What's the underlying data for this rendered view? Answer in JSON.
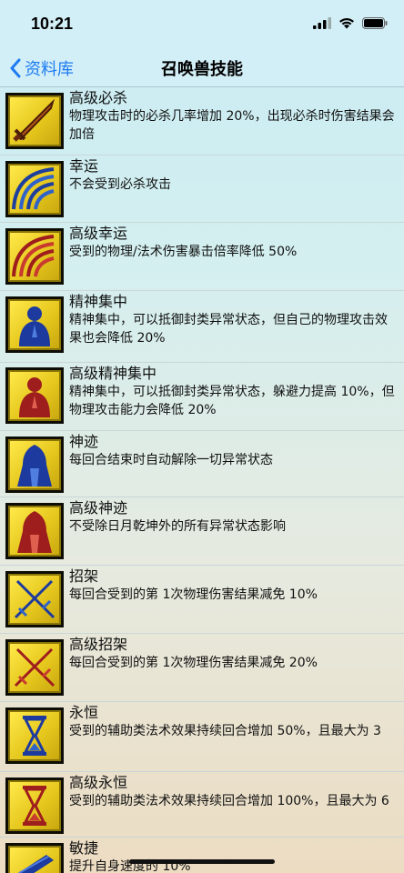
{
  "status": {
    "time": "10:21"
  },
  "nav": {
    "back_label": "资料库",
    "title": "召唤兽技能"
  },
  "skills": [
    {
      "name": "高级必杀",
      "desc": "物理攻击时的必杀几率增加 20%，出现必杀时伤害结果会加倍",
      "icon": "sword-icon"
    },
    {
      "name": "幸运",
      "desc": "不会受到必杀攻击",
      "icon": "blue-rainbow-icon"
    },
    {
      "name": "高级幸运",
      "desc": "受到的物理/法术伤害暴击倍率降低 50%",
      "icon": "red-rainbow-icon"
    },
    {
      "name": "精神集中",
      "desc": "精神集中，可以抵御封类异常状态，但自己的物理攻击效果也会降低 20%",
      "icon": "blue-praying-figure-icon"
    },
    {
      "name": "高级精神集中",
      "desc": "精神集中，可以抵御封类异常状态，躲避力提高 10%，但物理攻击能力会降低 20%",
      "icon": "red-praying-figure-icon"
    },
    {
      "name": "神迹",
      "desc": "每回合结束时自动解除一切异常状态",
      "icon": "blue-hooded-figure-icon"
    },
    {
      "name": "高级神迹",
      "desc": "不受除日月乾坤外的所有异常状态影响",
      "icon": "red-hooded-figure-icon"
    },
    {
      "name": "招架",
      "desc": "每回合受到的第 1次物理伤害结果减免 10%",
      "icon": "blue-crossed-swords-icon"
    },
    {
      "name": "高级招架",
      "desc": "每回合受到的第 1次物理伤害结果减免 20%",
      "icon": "red-crossed-swords-icon"
    },
    {
      "name": "永恒",
      "desc": "受到的辅助类法术效果持续回合增加 50%，且最大为 3",
      "icon": "blue-hourglass-icon"
    },
    {
      "name": "高级永恒",
      "desc": "受到的辅助类法术效果持续回合增加 100%，且最大为 6",
      "icon": "red-hourglass-icon"
    },
    {
      "name": "敏捷",
      "desc": "提升自身速度的 10%",
      "icon": "feather-icon"
    }
  ]
}
